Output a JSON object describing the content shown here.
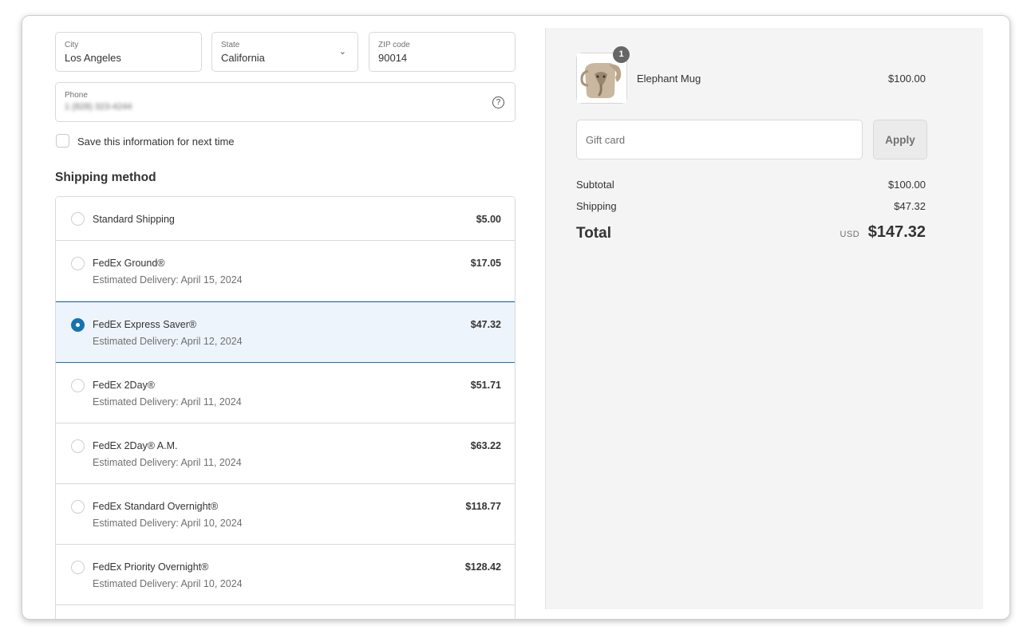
{
  "address": {
    "city": {
      "label": "City",
      "value": "Los Angeles"
    },
    "state": {
      "label": "State",
      "value": "California"
    },
    "zip": {
      "label": "ZIP code",
      "value": "90014"
    },
    "phone": {
      "label": "Phone",
      "value": "1 (828) 323-4244"
    },
    "save_info_label": "Save this information for next time"
  },
  "shipping": {
    "title": "Shipping method",
    "options": [
      {
        "name": "Standard Shipping",
        "estimate": "",
        "price": "$5.00",
        "selected": false
      },
      {
        "name": "FedEx Ground®",
        "estimate": "Estimated Delivery: April 15, 2024",
        "price": "$17.05",
        "selected": false
      },
      {
        "name": "FedEx Express Saver®",
        "estimate": "Estimated Delivery: April 12, 2024",
        "price": "$47.32",
        "selected": true
      },
      {
        "name": "FedEx 2Day®",
        "estimate": "Estimated Delivery: April 11, 2024",
        "price": "$51.71",
        "selected": false
      },
      {
        "name": "FedEx 2Day® A.M.",
        "estimate": "Estimated Delivery: April 11, 2024",
        "price": "$63.22",
        "selected": false
      },
      {
        "name": "FedEx Standard Overnight®",
        "estimate": "Estimated Delivery: April 10, 2024",
        "price": "$118.77",
        "selected": false
      },
      {
        "name": "FedEx Priority Overnight®",
        "estimate": "Estimated Delivery: April 10, 2024",
        "price": "$128.42",
        "selected": false
      }
    ]
  },
  "summary": {
    "product": {
      "name": "Elephant Mug",
      "price": "$100.00",
      "quantity": "1"
    },
    "gift_card": {
      "placeholder": "Gift card",
      "apply_label": "Apply"
    },
    "subtotal": {
      "label": "Subtotal",
      "value": "$100.00"
    },
    "shipping": {
      "label": "Shipping",
      "value": "$47.32"
    },
    "total": {
      "label": "Total",
      "currency": "USD",
      "value": "$147.32"
    }
  },
  "colors": {
    "accent": "#1773b0",
    "selected_bg": "#eef4fb",
    "summary_bg": "#f4f4f4"
  }
}
